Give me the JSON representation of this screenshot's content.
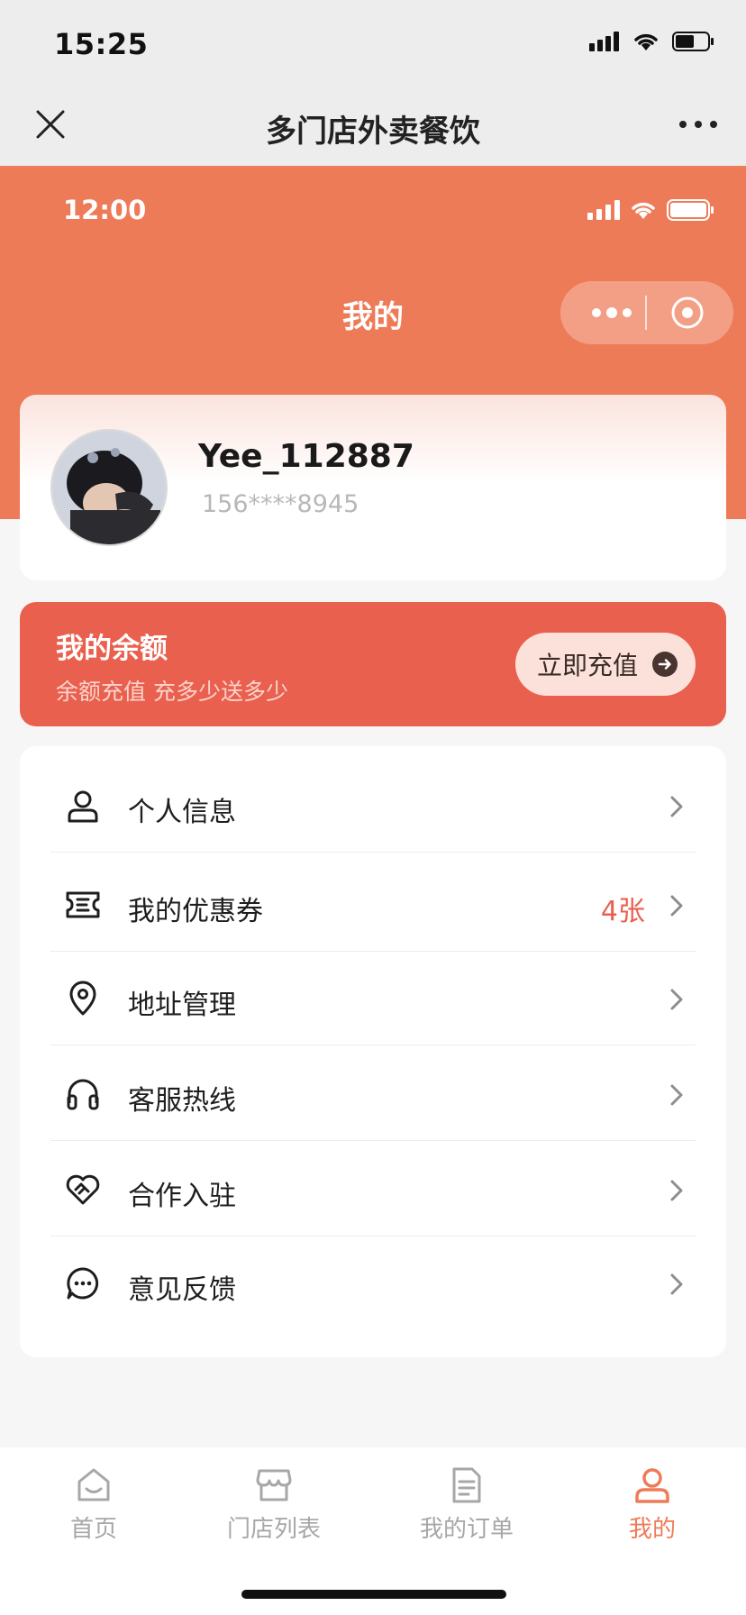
{
  "os_status": {
    "time": "15:25",
    "icons": [
      "signal-icon",
      "wifi-icon",
      "battery-icon"
    ]
  },
  "wechat_nav": {
    "title": "多门店外卖餐饮",
    "left_icon": "close-icon",
    "right_icon": "more-icon"
  },
  "mini_status": {
    "time": "12:00"
  },
  "header": {
    "title": "我的",
    "capsule_icons": [
      "more-dots-icon",
      "target-icon"
    ]
  },
  "profile": {
    "username": "Yee_112887",
    "phone": "156****8945"
  },
  "balance": {
    "title": "我的余额",
    "subtitle": "余额充值 充多少送多少",
    "button_label": "立即充值"
  },
  "menu": {
    "items": [
      {
        "label": "个人信息",
        "icon": "user-icon",
        "badge": ""
      },
      {
        "label": "我的优惠券",
        "icon": "coupon-icon",
        "badge": "4张"
      },
      {
        "label": "地址管理",
        "icon": "location-icon",
        "badge": ""
      },
      {
        "label": "客服热线",
        "icon": "headset-icon",
        "badge": ""
      },
      {
        "label": "合作入驻",
        "icon": "handshake-heart-icon",
        "badge": ""
      },
      {
        "label": "意见反馈",
        "icon": "chat-bubble-icon",
        "badge": ""
      }
    ]
  },
  "tabbar": {
    "tabs": [
      {
        "label": "首页",
        "icon": "home-icon",
        "active": false
      },
      {
        "label": "门店列表",
        "icon": "store-icon",
        "active": false
      },
      {
        "label": "我的订单",
        "icon": "order-icon",
        "active": false
      },
      {
        "label": "我的",
        "icon": "profile-icon",
        "active": true
      }
    ]
  },
  "colors": {
    "accent": "#ee7b58",
    "balance_card": "#e9604f",
    "badge": "#e9604f",
    "inactive_tab": "#a7a7a7"
  }
}
